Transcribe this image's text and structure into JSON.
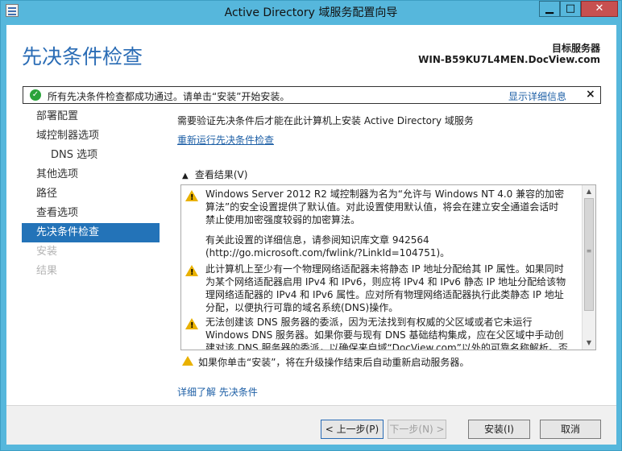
{
  "window": {
    "title": "Active Directory 域服务配置向导",
    "min_glyph": "▁",
    "max_glyph": "□",
    "close_glyph": "✕"
  },
  "header": {
    "page_title": "先决条件检查",
    "target_label": "目标服务器",
    "target_server": "WIN-B59KU7L4MEN.DocView.com"
  },
  "notification": {
    "message": "所有先决条件检查都成功通过。请单击“安装”开始安装。",
    "details_link": "显示详细信息",
    "close_glyph": "×",
    "status_color": "#2aa33a"
  },
  "sidebar": {
    "items": [
      {
        "label": "部署配置",
        "state": "normal"
      },
      {
        "label": "域控制器选项",
        "state": "normal"
      },
      {
        "label": "DNS 选项",
        "state": "sub"
      },
      {
        "label": "其他选项",
        "state": "normal"
      },
      {
        "label": "路径",
        "state": "normal"
      },
      {
        "label": "查看选项",
        "state": "normal"
      },
      {
        "label": "先决条件检查",
        "state": "active"
      },
      {
        "label": "安装",
        "state": "disabled"
      },
      {
        "label": "结果",
        "state": "disabled"
      }
    ]
  },
  "main": {
    "requirement_text": "需要验证先决条件后才能在此计算机上安装 Active Directory 域服务",
    "rerun_link": "重新运行先决条件检查",
    "results_header": "查看结果(V)",
    "results": [
      "Windows Server 2012 R2 域控制器为名为“允许与 Windows NT 4.0 兼容的加密算法”的安全设置提供了默认值。对此设置使用默认值，将会在建立安全通道会话时禁止使用加密强度较弱的加密算法。",
      "有关此设置的详细信息，请参阅知识库文章 942564 (http://go.microsoft.com/fwlink/?LinkId=104751)。",
      "此计算机上至少有一个物理网络适配器未将静态 IP 地址分配给其 IP 属性。如果同时为某个网络适配器启用 IPv4 和 IPv6，则应将 IPv4 和 IPv6 静态 IP 地址分配给该物理网络适配器的 IPv4 和 IPv6 属性。应对所有物理网络适配器执行此类静态 IP 地址分配，以便执行可靠的域名系统(DNS)操作。",
      "无法创建该 DNS 服务器的委派，因为无法找到有权威的父区域或者它未运行 Windows DNS 服务器。如果你要与现有 DNS 基础结构集成，应在父区域中手动创建对该 DNS 服务器的委派，以确保来自域“DocView.com”以外的可靠名称解析。否则，不需要执行"
    ],
    "install_warning": "如果你单击“安装”，将在升级操作结束后自动重新启动服务器。",
    "learn_more": "详细了解 先决条件"
  },
  "footer": {
    "prev_button": "< 上一步(P)",
    "next_button": "下一步(N) >",
    "install_button": "安装(I)",
    "cancel_button": "取消"
  },
  "colors": {
    "accent": "#2373b8",
    "title_blue": "#2a6cb5",
    "chrome": "#56b7dc",
    "warning": "#e9b100"
  }
}
